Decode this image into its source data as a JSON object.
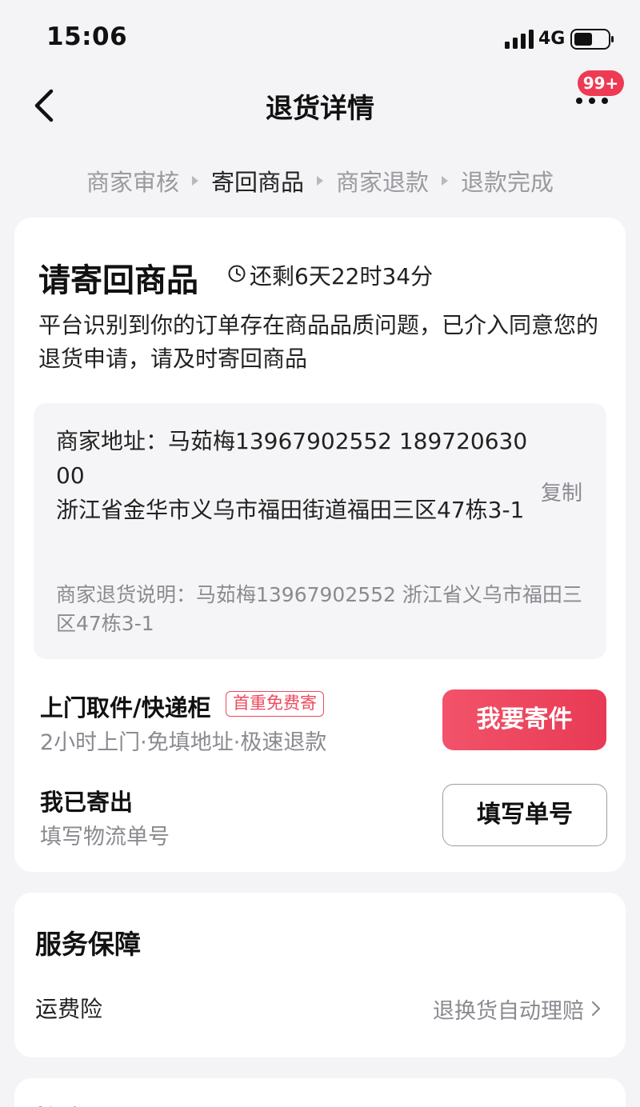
{
  "status_bar": {
    "time": "15:06",
    "network": "4G",
    "icons": [
      "signal-icon",
      "battery-icon"
    ]
  },
  "nav": {
    "title": "退货详情",
    "badge": "99+",
    "icons": [
      "back-icon",
      "more-icon"
    ]
  },
  "steps": [
    {
      "label": "商家审核",
      "active": false
    },
    {
      "label": "寄回商品",
      "active": true
    },
    {
      "label": "商家退款",
      "active": false
    },
    {
      "label": "退款完成",
      "active": false
    }
  ],
  "main": {
    "title": "请寄回商品",
    "countdown": "还剩6天22时34分",
    "notice": "平台识别到你的订单存在商品品质问题，已介入同意您的退货申请，请及时寄回商品",
    "address": {
      "line1": "商家地址：马茹梅13967902552  18972063000",
      "line2": "浙江省金华市义乌市福田街道福田三区47栋3-1",
      "copy_label": "复制",
      "return_note": "商家退货说明：马茹梅13967902552 浙江省义乌市福田三区47栋3-1"
    },
    "pickup": {
      "title": "上门取件/快递柜",
      "tag": "首重免费寄",
      "subtitle": "2小时上门·免填地址·极速退款",
      "button": "我要寄件"
    },
    "shipped": {
      "title": "我已寄出",
      "subtitle": "填写物流单号",
      "button": "填写单号"
    }
  },
  "service": {
    "title": "服务保障",
    "item_label": "运费险",
    "item_value": "退换货自动理赔"
  },
  "next_section": {
    "title": "协商记录"
  },
  "colors": {
    "accent": "#ee3a52",
    "muted": "#8a8a90",
    "background": "#f4f4f6"
  }
}
